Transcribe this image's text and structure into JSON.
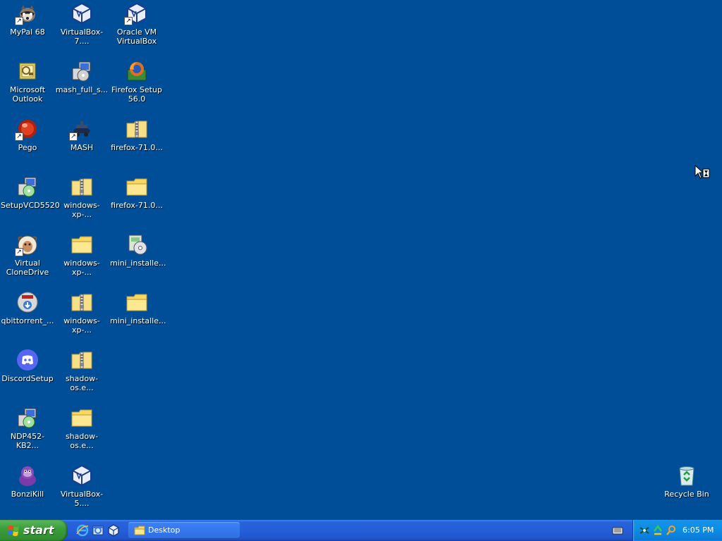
{
  "desktop": {
    "background_color": "#004e98",
    "icons": [
      {
        "id": "mypal",
        "label": "MyPal 68",
        "icon": "raccoon-icon",
        "shortcut": true
      },
      {
        "id": "virtualbox7",
        "label": "VirtualBox-7....",
        "icon": "virtualbox-icon",
        "shortcut": false
      },
      {
        "id": "oracle-vm",
        "label": "Oracle VM VirtualBox",
        "icon": "virtualbox-icon",
        "shortcut": true
      },
      {
        "id": "outlook",
        "label": "Microsoft Outlook",
        "icon": "outlook-icon",
        "shortcut": false
      },
      {
        "id": "mash-full",
        "label": "mash_full_s...",
        "icon": "installer-icon",
        "shortcut": false
      },
      {
        "id": "firefox-setup",
        "label": "Firefox Setup 56.0",
        "icon": "firefox-installer-icon",
        "shortcut": false
      },
      {
        "id": "pego",
        "label": "Pego",
        "icon": "red-ball-icon",
        "shortcut": true
      },
      {
        "id": "mash",
        "label": "MASH",
        "icon": "mash-icon",
        "shortcut": true
      },
      {
        "id": "firefox71-zip",
        "label": "firefox-71.0...",
        "icon": "zip-folder-icon",
        "shortcut": false
      },
      {
        "id": "setupvcd",
        "label": "SetupVCD5520",
        "icon": "installer-icon",
        "shortcut": false
      },
      {
        "id": "winxp-zip1",
        "label": "windows-xp-...",
        "icon": "zip-folder-icon",
        "shortcut": false
      },
      {
        "id": "firefox71-folder",
        "label": "firefox-71.0...",
        "icon": "folder-icon",
        "shortcut": false
      },
      {
        "id": "virtual-clonedrive",
        "label": "Virtual CloneDrive",
        "icon": "sheep-icon",
        "shortcut": true
      },
      {
        "id": "winxp-folder",
        "label": "windows-xp-...",
        "icon": "folder-icon",
        "shortcut": false
      },
      {
        "id": "mini-installer-exe",
        "label": "mini_installe...",
        "icon": "disc-installer-icon",
        "shortcut": false
      },
      {
        "id": "qbittorrent",
        "label": "qbittorrent_...",
        "icon": "qbittorrent-icon",
        "shortcut": false
      },
      {
        "id": "winxp-zip2",
        "label": "windows-xp-...",
        "icon": "zip-folder-icon",
        "shortcut": false
      },
      {
        "id": "mini-installer-folder",
        "label": "mini_installe...",
        "icon": "folder-icon",
        "shortcut": false
      },
      {
        "id": "discord",
        "label": "DiscordSetup",
        "icon": "discord-icon",
        "shortcut": false
      },
      {
        "id": "shadow-zip",
        "label": "shadow-os.e...",
        "icon": "zip-folder-icon",
        "shortcut": false
      },
      {
        "id": "ndp452",
        "label": "NDP452-KB2...",
        "icon": "installer-icon",
        "shortcut": false
      },
      {
        "id": "shadow-folder",
        "label": "shadow-os.e...",
        "icon": "folder-icon",
        "shortcut": false
      },
      {
        "id": "bonzikill",
        "label": "BonziKill",
        "icon": "purple-gorilla-icon",
        "shortcut": false
      },
      {
        "id": "virtualbox5",
        "label": "VirtualBox-5....",
        "icon": "virtualbox-icon",
        "shortcut": false
      },
      {
        "id": "recycle-bin",
        "label": "Recycle Bin",
        "icon": "recycle-bin-icon",
        "shortcut": false
      }
    ]
  },
  "taskbar": {
    "start_label": "start",
    "quick_launch": [
      "internet-explorer-icon",
      "show-desktop-icon",
      "virtualbox-icon"
    ],
    "tasks": [
      {
        "label": "Desktop",
        "icon": "folder-icon"
      }
    ],
    "tray_icons": [
      "network-icon",
      "recycle-tray-icon",
      "search-tray-icon"
    ],
    "clock": "6:05 PM"
  }
}
